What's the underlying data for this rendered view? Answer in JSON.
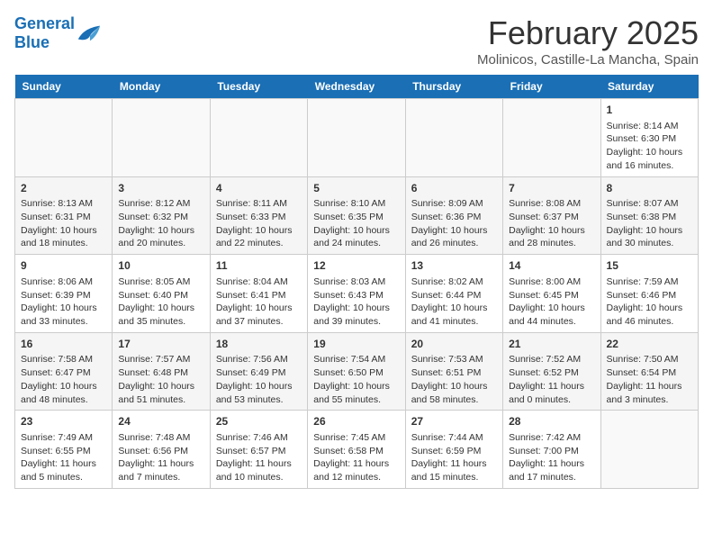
{
  "logo": {
    "text_general": "General",
    "text_blue": "Blue"
  },
  "header": {
    "month": "February 2025",
    "location": "Molinicos, Castille-La Mancha, Spain"
  },
  "days_of_week": [
    "Sunday",
    "Monday",
    "Tuesday",
    "Wednesday",
    "Thursday",
    "Friday",
    "Saturday"
  ],
  "weeks": [
    [
      {
        "day": "",
        "info": ""
      },
      {
        "day": "",
        "info": ""
      },
      {
        "day": "",
        "info": ""
      },
      {
        "day": "",
        "info": ""
      },
      {
        "day": "",
        "info": ""
      },
      {
        "day": "",
        "info": ""
      },
      {
        "day": "1",
        "info": "Sunrise: 8:14 AM\nSunset: 6:30 PM\nDaylight: 10 hours and 16 minutes."
      }
    ],
    [
      {
        "day": "2",
        "info": "Sunrise: 8:13 AM\nSunset: 6:31 PM\nDaylight: 10 hours and 18 minutes."
      },
      {
        "day": "3",
        "info": "Sunrise: 8:12 AM\nSunset: 6:32 PM\nDaylight: 10 hours and 20 minutes."
      },
      {
        "day": "4",
        "info": "Sunrise: 8:11 AM\nSunset: 6:33 PM\nDaylight: 10 hours and 22 minutes."
      },
      {
        "day": "5",
        "info": "Sunrise: 8:10 AM\nSunset: 6:35 PM\nDaylight: 10 hours and 24 minutes."
      },
      {
        "day": "6",
        "info": "Sunrise: 8:09 AM\nSunset: 6:36 PM\nDaylight: 10 hours and 26 minutes."
      },
      {
        "day": "7",
        "info": "Sunrise: 8:08 AM\nSunset: 6:37 PM\nDaylight: 10 hours and 28 minutes."
      },
      {
        "day": "8",
        "info": "Sunrise: 8:07 AM\nSunset: 6:38 PM\nDaylight: 10 hours and 30 minutes."
      }
    ],
    [
      {
        "day": "9",
        "info": "Sunrise: 8:06 AM\nSunset: 6:39 PM\nDaylight: 10 hours and 33 minutes."
      },
      {
        "day": "10",
        "info": "Sunrise: 8:05 AM\nSunset: 6:40 PM\nDaylight: 10 hours and 35 minutes."
      },
      {
        "day": "11",
        "info": "Sunrise: 8:04 AM\nSunset: 6:41 PM\nDaylight: 10 hours and 37 minutes."
      },
      {
        "day": "12",
        "info": "Sunrise: 8:03 AM\nSunset: 6:43 PM\nDaylight: 10 hours and 39 minutes."
      },
      {
        "day": "13",
        "info": "Sunrise: 8:02 AM\nSunset: 6:44 PM\nDaylight: 10 hours and 41 minutes."
      },
      {
        "day": "14",
        "info": "Sunrise: 8:00 AM\nSunset: 6:45 PM\nDaylight: 10 hours and 44 minutes."
      },
      {
        "day": "15",
        "info": "Sunrise: 7:59 AM\nSunset: 6:46 PM\nDaylight: 10 hours and 46 minutes."
      }
    ],
    [
      {
        "day": "16",
        "info": "Sunrise: 7:58 AM\nSunset: 6:47 PM\nDaylight: 10 hours and 48 minutes."
      },
      {
        "day": "17",
        "info": "Sunrise: 7:57 AM\nSunset: 6:48 PM\nDaylight: 10 hours and 51 minutes."
      },
      {
        "day": "18",
        "info": "Sunrise: 7:56 AM\nSunset: 6:49 PM\nDaylight: 10 hours and 53 minutes."
      },
      {
        "day": "19",
        "info": "Sunrise: 7:54 AM\nSunset: 6:50 PM\nDaylight: 10 hours and 55 minutes."
      },
      {
        "day": "20",
        "info": "Sunrise: 7:53 AM\nSunset: 6:51 PM\nDaylight: 10 hours and 58 minutes."
      },
      {
        "day": "21",
        "info": "Sunrise: 7:52 AM\nSunset: 6:52 PM\nDaylight: 11 hours and 0 minutes."
      },
      {
        "day": "22",
        "info": "Sunrise: 7:50 AM\nSunset: 6:54 PM\nDaylight: 11 hours and 3 minutes."
      }
    ],
    [
      {
        "day": "23",
        "info": "Sunrise: 7:49 AM\nSunset: 6:55 PM\nDaylight: 11 hours and 5 minutes."
      },
      {
        "day": "24",
        "info": "Sunrise: 7:48 AM\nSunset: 6:56 PM\nDaylight: 11 hours and 7 minutes."
      },
      {
        "day": "25",
        "info": "Sunrise: 7:46 AM\nSunset: 6:57 PM\nDaylight: 11 hours and 10 minutes."
      },
      {
        "day": "26",
        "info": "Sunrise: 7:45 AM\nSunset: 6:58 PM\nDaylight: 11 hours and 12 minutes."
      },
      {
        "day": "27",
        "info": "Sunrise: 7:44 AM\nSunset: 6:59 PM\nDaylight: 11 hours and 15 minutes."
      },
      {
        "day": "28",
        "info": "Sunrise: 7:42 AM\nSunset: 7:00 PM\nDaylight: 11 hours and 17 minutes."
      },
      {
        "day": "",
        "info": ""
      }
    ]
  ]
}
